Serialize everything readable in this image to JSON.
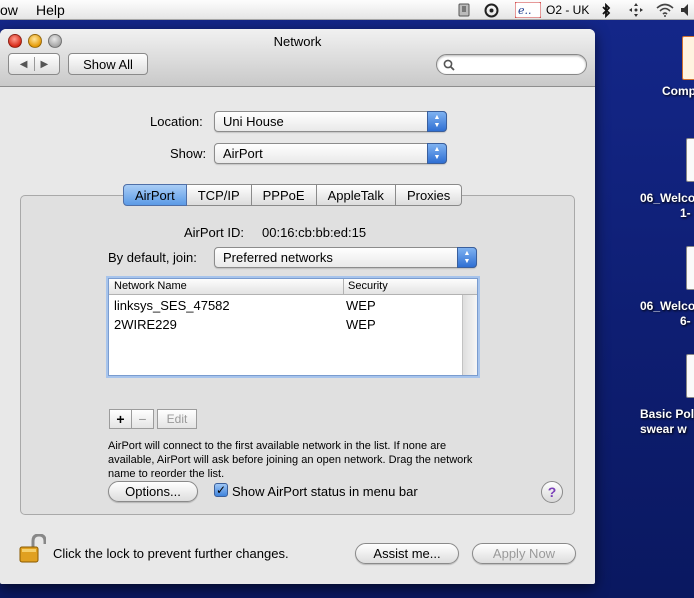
{
  "menubar": {
    "items": [
      "ow",
      "Help"
    ],
    "carrier": "O2 - UK"
  },
  "window": {
    "title": "Network",
    "show_all_label": "Show All",
    "search_placeholder": ""
  },
  "location": {
    "label": "Location:",
    "value": "Uni House"
  },
  "show": {
    "label": "Show:",
    "value": "AirPort"
  },
  "tabs": [
    "AirPort",
    "TCP/IP",
    "PPPoE",
    "AppleTalk",
    "Proxies"
  ],
  "active_tab": "AirPort",
  "airport": {
    "id_label": "AirPort ID:",
    "id_value": "00:16:cb:bb:ed:15",
    "join_label": "By default, join:",
    "join_value": "Preferred networks",
    "columns": [
      "Network Name",
      "Security"
    ],
    "networks": [
      {
        "name": "linksys_SES_47582",
        "security": "WEP"
      },
      {
        "name": "2WIRE229",
        "security": "WEP"
      }
    ],
    "add_label": "+",
    "remove_label": "−",
    "edit_label": "Edit",
    "help_text": "AirPort will connect to the first available network in the list. If none are available, AirPort will ask before joining an open network. Drag the network name to reorder the list.",
    "options_label": "Options...",
    "show_status_label": "Show AirPort status in menu bar",
    "show_status_checked": true,
    "help_button": "?"
  },
  "footer": {
    "lock_text": "Click the lock to prevent further changes.",
    "assist_label": "Assist me...",
    "apply_label": "Apply Now"
  },
  "desktop": {
    "labels": [
      "Comp",
      "06_Welco",
      "1-",
      "06_Welco",
      "6-",
      "Basic Pol",
      "swear w"
    ]
  },
  "colors": {
    "accent_blue": "#3f83dc",
    "desktop_blue": "#0e1e72",
    "window_bg": "#e8e8e8"
  }
}
